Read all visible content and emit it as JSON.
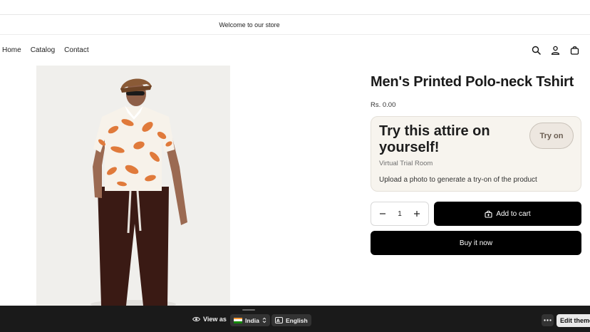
{
  "announcement": {
    "text": "Welcome to our store"
  },
  "nav": {
    "items": [
      "Home",
      "Catalog",
      "Contact"
    ]
  },
  "header_icons": [
    "search-icon",
    "account-icon",
    "cart-bag-icon"
  ],
  "product": {
    "title": "Men's Printed Polo-neck Tshirt",
    "price": "Rs. 0.00"
  },
  "tryon": {
    "headline": "Try this attire on yourself!",
    "button_label": "Try on",
    "subtitle": "Virtual Trial Room",
    "description": "Upload a photo to generate a try-on of the product"
  },
  "quantity": {
    "value": "1",
    "minus": "−",
    "plus": "+"
  },
  "buttons": {
    "add_to_cart": "Add to cart",
    "buy_now": "Buy it now"
  },
  "preview_bar": {
    "view_as": "View as",
    "country": "India",
    "language": "English",
    "edit_theme": "Edit theme"
  },
  "colors": {
    "accent": "#000000",
    "tryon_bg": "#f7f4ee",
    "bar_bg": "#1a1a1a"
  }
}
